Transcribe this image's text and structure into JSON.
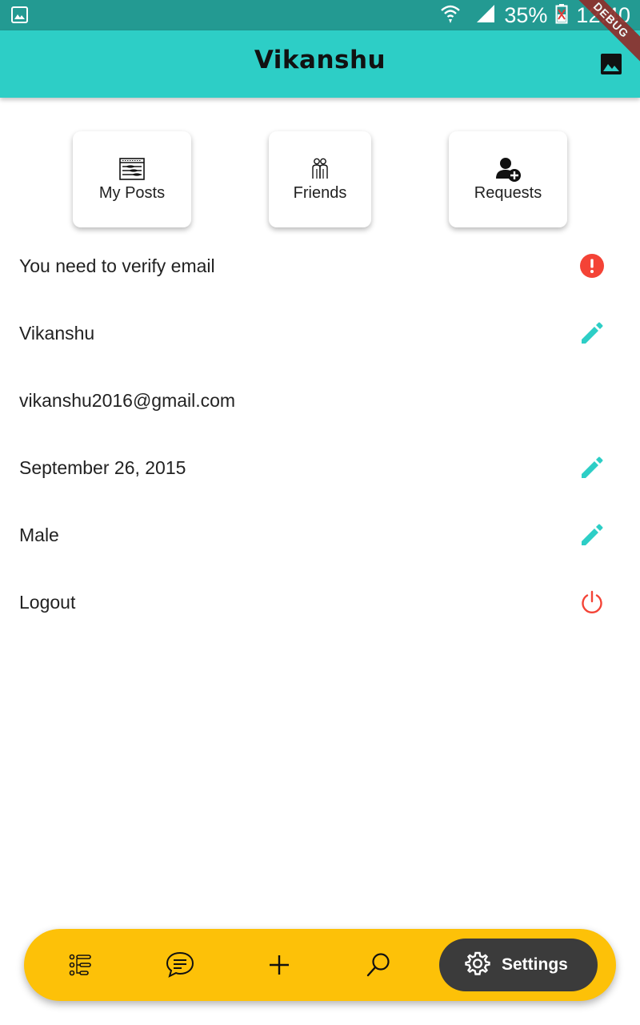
{
  "status_bar": {
    "battery": "35%",
    "time": "12:40"
  },
  "debug_banner": "DEBUG",
  "app_bar": {
    "title": "Vikanshu",
    "action_icon": "image-icon"
  },
  "cards": [
    {
      "label": "My Posts",
      "icon": "posts-icon"
    },
    {
      "label": "Friends",
      "icon": "friends-icon"
    },
    {
      "label": "Requests",
      "icon": "add-user-icon"
    }
  ],
  "profile_rows": [
    {
      "text": "You need to verify email",
      "icon": "alert-icon",
      "icon_color": "#f44336"
    },
    {
      "text": "Vikanshu",
      "icon": "edit-icon",
      "icon_color": "#2dcec6"
    },
    {
      "text": "vikanshu2016@gmail.com",
      "icon": "",
      "icon_color": ""
    },
    {
      "text": "September 26, 2015",
      "icon": "edit-icon",
      "icon_color": "#2dcec6"
    },
    {
      "text": "Male",
      "icon": "edit-icon",
      "icon_color": "#2dcec6"
    },
    {
      "text": "Logout",
      "icon": "power-icon",
      "icon_color": "#f44336"
    }
  ],
  "bottom_nav": {
    "items": [
      {
        "icon": "list-icon"
      },
      {
        "icon": "chat-icon"
      },
      {
        "icon": "plus-icon"
      },
      {
        "icon": "search-icon"
      }
    ],
    "active": {
      "icon": "gear-icon",
      "label": "Settings"
    }
  },
  "colors": {
    "status_bar": "#239a92",
    "app_bar": "#2dcec6",
    "accent_teal": "#2dcec6",
    "alert_red": "#f44336",
    "nav_yellow": "#fdc108",
    "nav_active": "#3b3b3b"
  }
}
